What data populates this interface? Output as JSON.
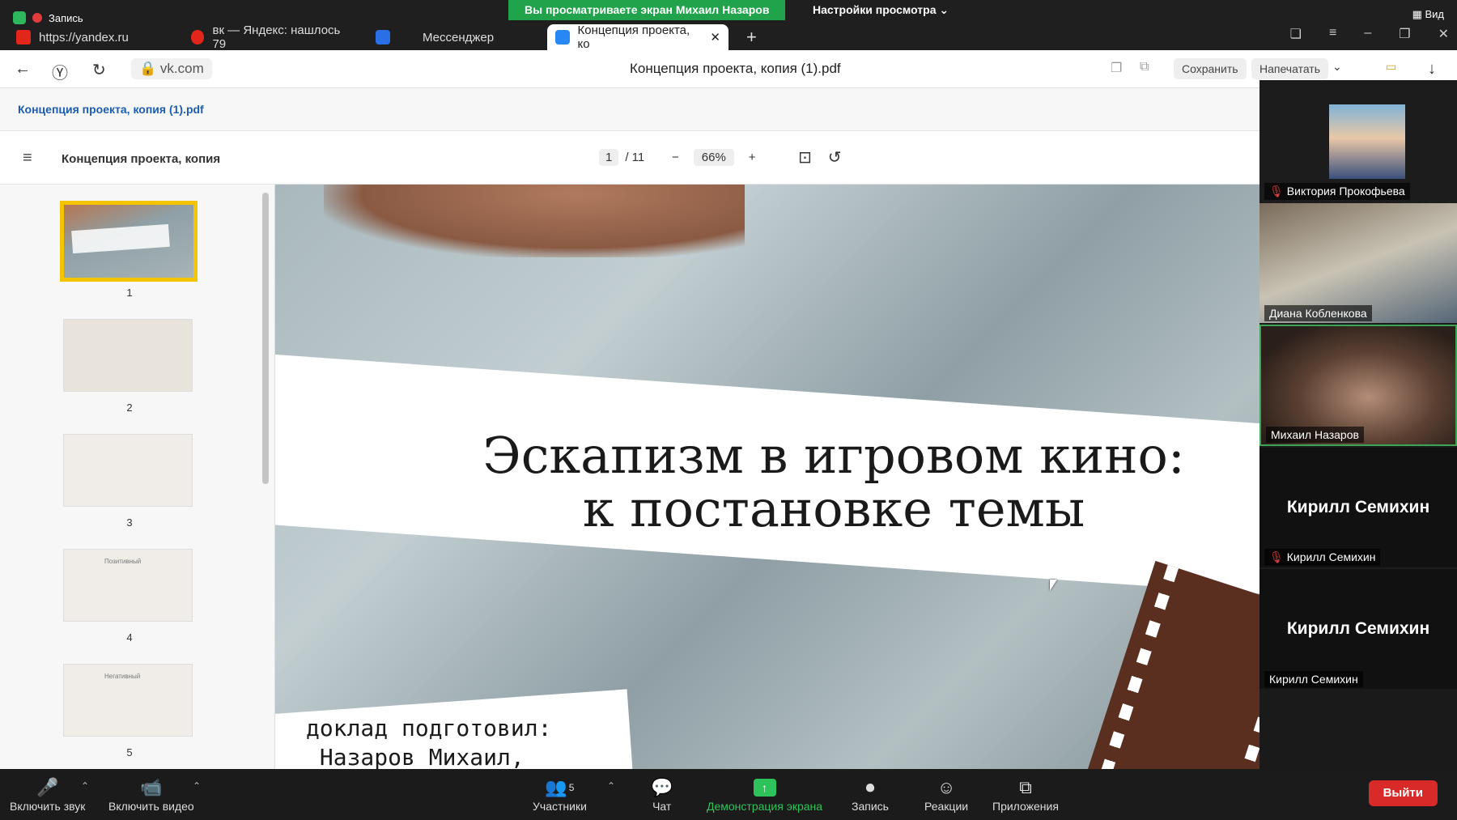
{
  "zoom_app": {
    "recording_label": "Запись",
    "share_banner": "Вы просматриваете экран Михаил Назаров",
    "view_settings": "Настройки просмотра ⌄",
    "view_button": "Вид"
  },
  "browser": {
    "tabs": [
      {
        "label": "https://yandex.ru"
      },
      {
        "label": "вк — Яндекс: нашлось 79"
      },
      {
        "label": "Мессенджер"
      },
      {
        "label": "Концепция проекта, ко"
      }
    ],
    "url": "vk.com",
    "doc_title": "Концепция проекта, копия (1).pdf",
    "save_label": "Сохранить",
    "print_label": "Напечатать"
  },
  "pdf": {
    "file_name": "Концепция проекта, копия (1).pdf",
    "title": "Концепция проекта, копия",
    "page_current": "1",
    "page_total": "/ 11",
    "zoom": "66%",
    "thumbnails": [
      {
        "num": "1"
      },
      {
        "num": "2"
      },
      {
        "num": "3"
      },
      {
        "num": "4",
        "title": "Позитивный"
      },
      {
        "num": "5",
        "title": "Негативный"
      }
    ]
  },
  "slide": {
    "title_line1": "Эскапизм в игровом кино:",
    "title_line2": "к постановке темы",
    "author_line1": "доклад подготовил:",
    "author_line2": "Назаров Михаил,"
  },
  "participants": [
    {
      "name": "Виктория Прокофьева"
    },
    {
      "name": "Диана Кобленкова"
    },
    {
      "name": "Михаил Назаров"
    },
    {
      "name": "Кирилл Семихин",
      "big": "Кирилл Семихин"
    },
    {
      "name": "Кирилл Семихин",
      "big": "Кирилл Семихин"
    }
  ],
  "controls": {
    "audio": "Включить звук",
    "video": "Включить видео",
    "participants": "Участники",
    "participants_count": "5",
    "chat": "Чат",
    "share": "Демонстрация экрана",
    "record": "Запись",
    "reactions": "Реакции",
    "apps": "Приложения",
    "leave": "Выйти"
  }
}
